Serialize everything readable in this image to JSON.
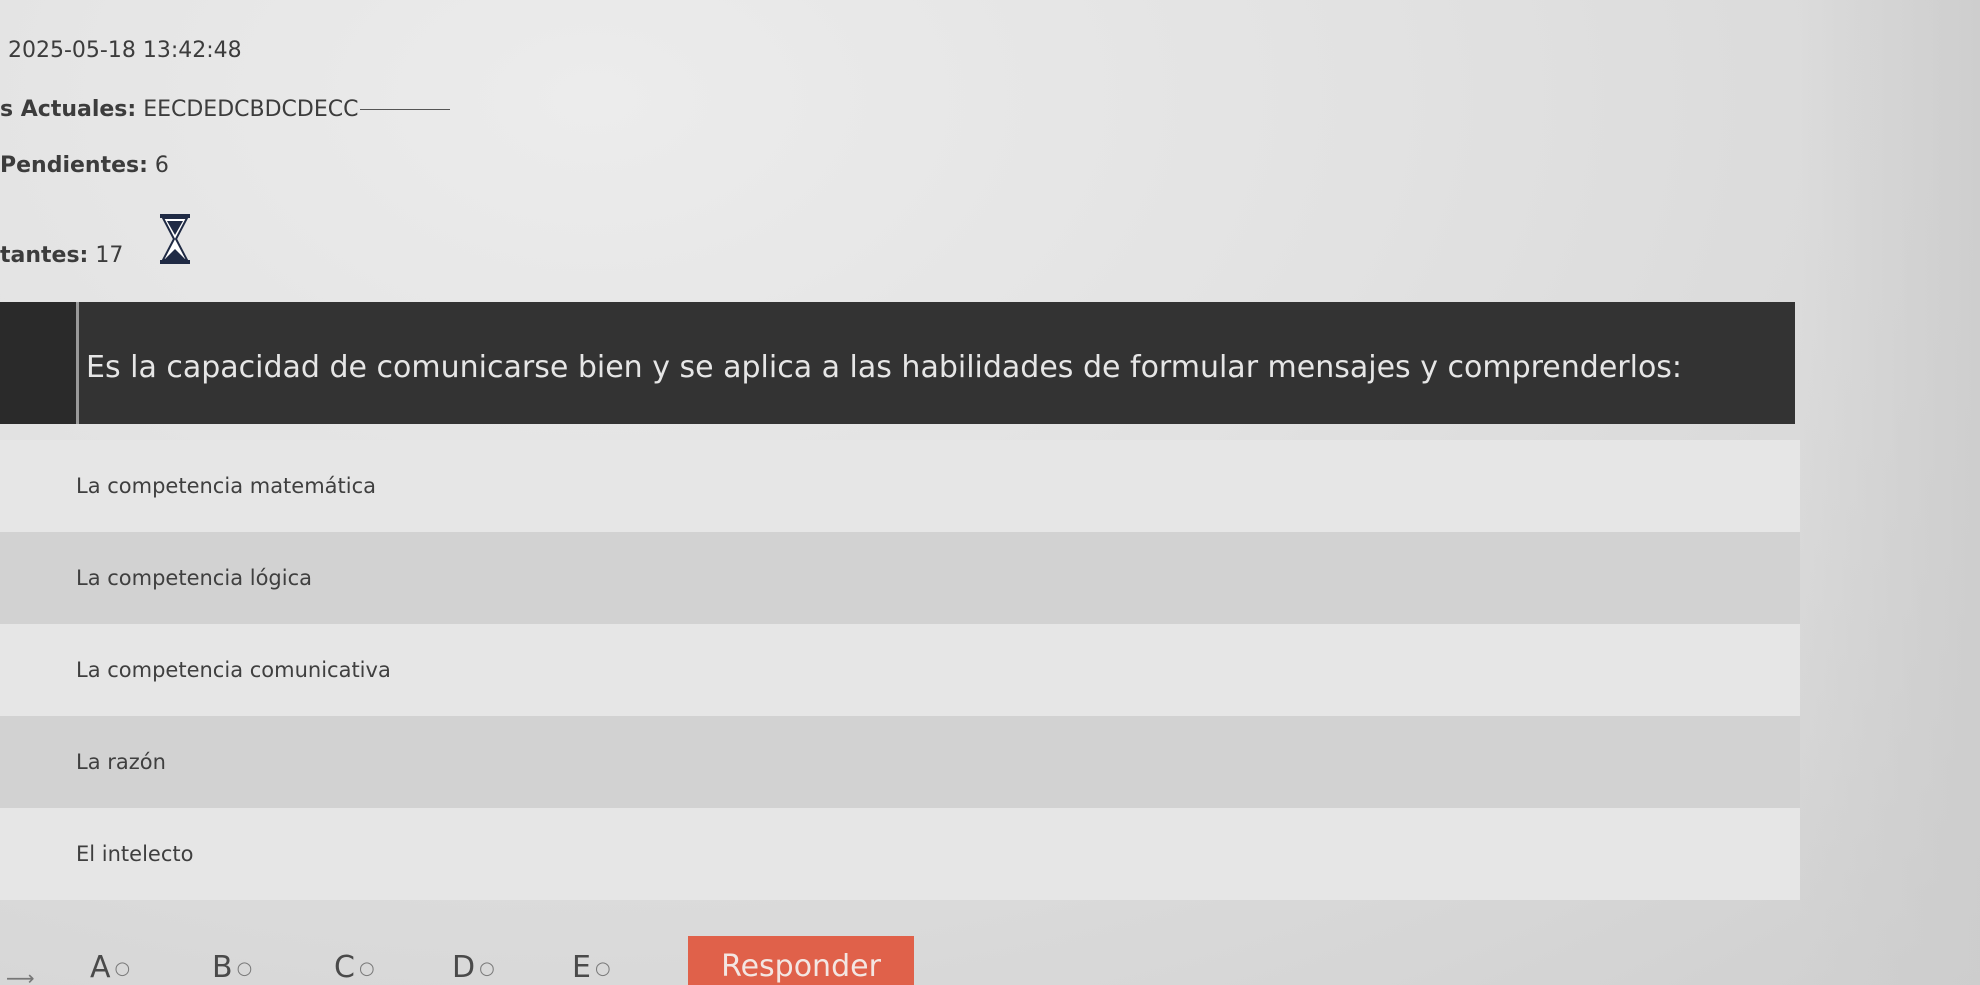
{
  "status": {
    "datetime": "2025-05-18 13:42:48",
    "actual_label": "s Actuales:",
    "actual_value": "EECDEDCBDCDECC",
    "pending_label": "Pendientes:",
    "pending_value": "6",
    "remaining_label": "tantes:",
    "remaining_value": "17",
    "timer_icon": "hourglass-icon"
  },
  "question": {
    "text": "Es la capacidad de comunicarse bien y se aplica a las habilidades de formular mensajes y comprenderlos:"
  },
  "options": [
    {
      "text": "La competencia matemática"
    },
    {
      "text": "La competencia lógica"
    },
    {
      "text": "La competencia comunicativa"
    },
    {
      "text": "La razón"
    },
    {
      "text": "El intelecto"
    }
  ],
  "answer_bar": {
    "choices": [
      "A",
      "B",
      "C",
      "D",
      "E"
    ],
    "radio_glyph": "○",
    "submit_label": "Responder"
  },
  "colors": {
    "question_bg": "#333333",
    "submit_bg": "#e0614a",
    "row_light": "#e6e6e6",
    "row_dark": "#d2d2d2"
  }
}
